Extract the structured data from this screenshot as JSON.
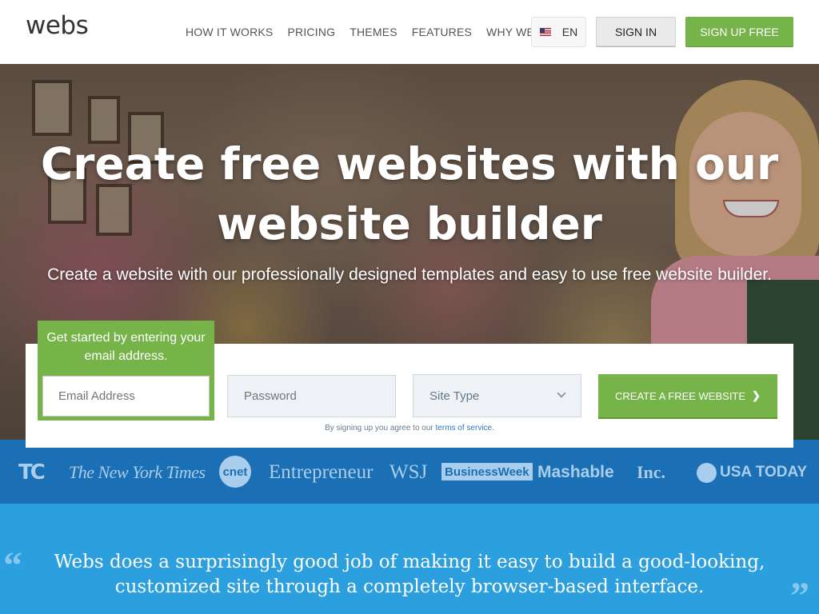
{
  "header": {
    "logo": "webs",
    "nav": [
      "HOW IT WORKS",
      "PRICING",
      "THEMES",
      "FEATURES",
      "WHY WEBS"
    ],
    "lang": "EN",
    "signin": "SIGN IN",
    "signup": "SIGN UP FREE"
  },
  "hero": {
    "title_line1": "Create free websites with our",
    "title_line2": "website builder",
    "subtitle": "Create a website with our professionally designed templates and easy to use free website builder."
  },
  "signup": {
    "prompt": "Get started by entering your email address.",
    "email_placeholder": "Email Address",
    "password_placeholder": "Password",
    "site_type": "Site Type",
    "button": "CREATE A FREE WEBSITE",
    "tos_text": "By signing up you agree to our ",
    "tos_link": "terms of service"
  },
  "press": {
    "tc": "TC",
    "nyt": "The New York Times",
    "cnet": "cnet",
    "entrepreneur": "Entrepreneur",
    "wsj": "WSJ",
    "businessweek": "BusinessWeek",
    "mashable": "Mashable",
    "inc": "Inc.",
    "usatoday": "USA TODAY"
  },
  "quote": {
    "line1": "Webs does a surprisingly good job of making it easy to build a good-looking,",
    "line2": "customized site through a completely browser-based interface.",
    "open_mark": "“",
    "close_mark": "”"
  },
  "colors": {
    "brand_green": "#76b348",
    "press_blue": "#1b6fb5",
    "quote_blue": "#2c9fde"
  }
}
